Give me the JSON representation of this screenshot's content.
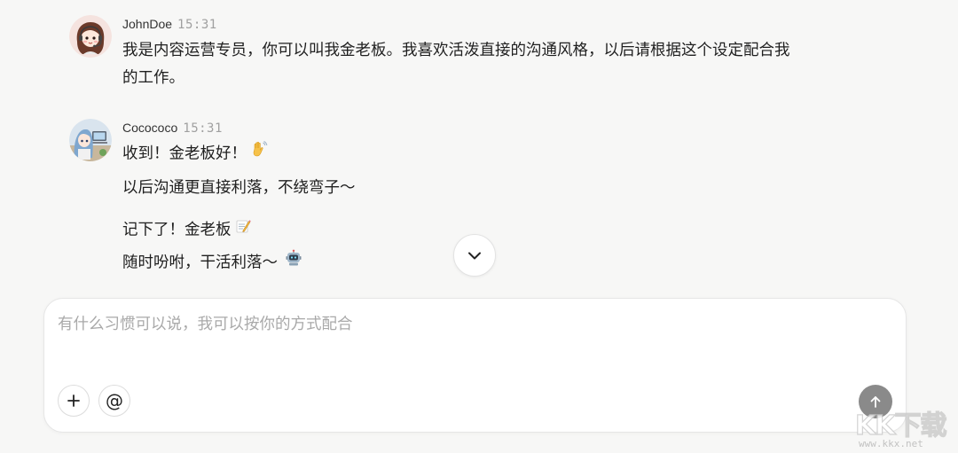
{
  "messages": [
    {
      "author": "JohnDoe",
      "time": "15:31",
      "lines": [
        "我是内容运营专员，你可以叫我金老板。我喜欢活泼直接的沟通风格，以后请根据这个设定配合我",
        "的工作。"
      ]
    },
    {
      "author": "Cocococo",
      "time": "15:31",
      "lines": [
        "收到！金老板好！",
        "以后沟通更直接利落，不绕弯子～",
        "记下了！金老板",
        "随时吩咐，干活利落～"
      ],
      "emojis": [
        "waving-hand",
        "memo",
        "robot"
      ]
    }
  ],
  "composer": {
    "placeholder": "有什么习惯可以说，我可以按你的方式配合",
    "value": ""
  },
  "buttons": {
    "scroll_down_icon": "chevron-down-icon",
    "add_icon": "plus-icon",
    "mention_label": "@",
    "send_icon": "arrow-up-icon"
  },
  "watermark": {
    "logo": "KK下载",
    "url": "www.kkx.net"
  },
  "colors": {
    "background": "#f7f7f6",
    "send_button": "#8a8a8a",
    "timestamp": "#a0a0a0"
  }
}
